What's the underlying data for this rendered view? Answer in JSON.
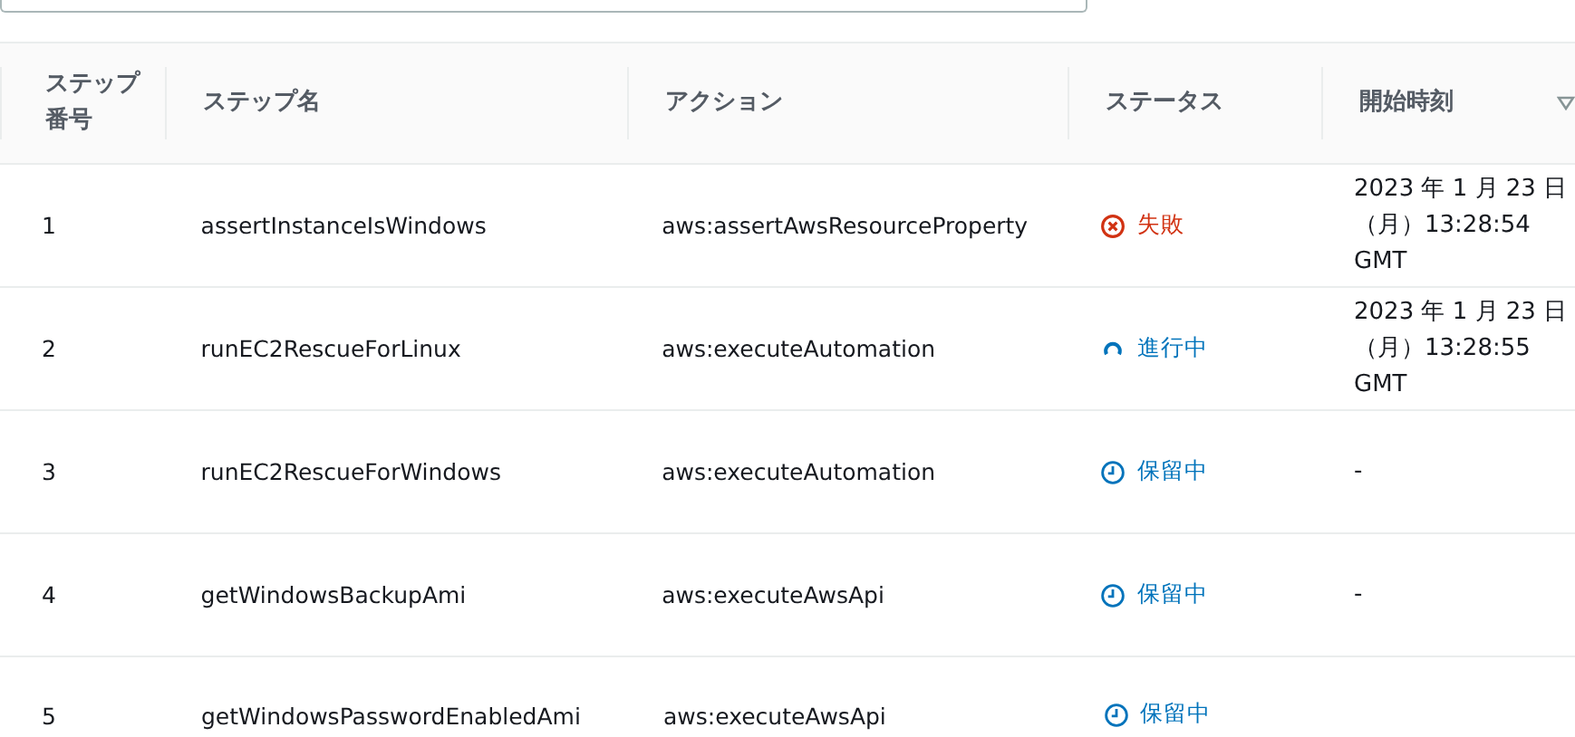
{
  "table": {
    "columns": [
      {
        "label": "ステップ番号",
        "sorted": false
      },
      {
        "label": "ステップ名",
        "sorted": false
      },
      {
        "label": "アクション",
        "sorted": false
      },
      {
        "label": "ステータス",
        "sorted": false
      },
      {
        "label": "開始時刻",
        "sorted": true
      }
    ],
    "rows": [
      {
        "number": "1",
        "name": "assertInstanceIsWindows",
        "action": "aws:assertAwsResourceProperty",
        "status": {
          "kind": "failed",
          "label": "失敗"
        },
        "start_time": "2023 年 1 月 23 日（月）13:28:54 GMT"
      },
      {
        "number": "2",
        "name": "runEC2RescueForLinux",
        "action": "aws:executeAutomation",
        "status": {
          "kind": "running",
          "label": "進行中"
        },
        "start_time": "2023 年 1 月 23 日（月）13:28:55 GMT"
      },
      {
        "number": "3",
        "name": "runEC2RescueForWindows",
        "action": "aws:executeAutomation",
        "status": {
          "kind": "pending",
          "label": "保留中"
        },
        "start_time": "-"
      },
      {
        "number": "4",
        "name": "getWindowsBackupAmi",
        "action": "aws:executeAwsApi",
        "status": {
          "kind": "pending",
          "label": "保留中"
        },
        "start_time": "-"
      },
      {
        "number": "5",
        "name": "getWindowsPasswordEnabledAmi",
        "action": "aws:executeAwsApi",
        "status": {
          "kind": "pending",
          "label": "保留中"
        },
        "start_time": ""
      }
    ]
  }
}
